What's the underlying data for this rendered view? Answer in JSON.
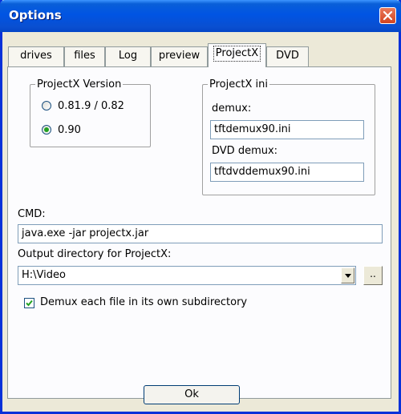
{
  "window": {
    "title": "Options",
    "close_icon": "close-icon"
  },
  "tabs": [
    "drives",
    "files",
    "Log",
    "preview",
    "ProjectX",
    "DVD"
  ],
  "active_tab": "ProjectX",
  "version_group": {
    "label": "ProjectX Version",
    "options": [
      "0.81.9 / 0.82",
      "0.90"
    ],
    "selected": "0.90"
  },
  "ini_group": {
    "label": "ProjectX ini",
    "demux_label": "demux:",
    "demux_value": "tftdemux90.ini",
    "dvd_demux_label": "DVD demux:",
    "dvd_demux_value": "tftdvddemux90.ini"
  },
  "cmd": {
    "label": "CMD:",
    "value": "java.exe -jar projectx.jar"
  },
  "output_dir": {
    "label": "Output directory for ProjectX:",
    "value": "H:\\Video",
    "browse_label": ".."
  },
  "subdir_checkbox": {
    "label": "Demux each file in its own subdirectory",
    "checked": true
  },
  "ok_button": "Ok"
}
